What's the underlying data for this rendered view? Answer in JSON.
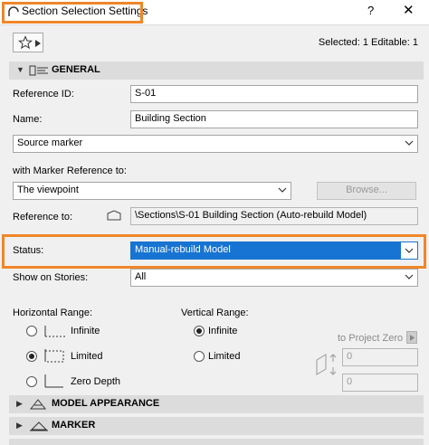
{
  "window": {
    "title": "Section Selection Settings",
    "help": "?",
    "close": "✕"
  },
  "toolbar": {
    "favorites_icon": "star-icon",
    "selected_info": "Selected: 1 Editable: 1"
  },
  "general": {
    "header": "GENERAL",
    "reference_id_label": "Reference ID:",
    "reference_id_value": "S-01",
    "name_label": "Name:",
    "name_value": "Building Section",
    "marker_type_value": "Source marker",
    "marker_ref_label": "with Marker Reference to:",
    "marker_ref_value": "The viewpoint",
    "browse_label": "Browse...",
    "reference_to_label": "Reference to:",
    "reference_to_value": "\\Sections\\S-01 Building Section (Auto-rebuild Model)",
    "status_label": "Status:",
    "status_value": "Manual-rebuild Model",
    "stories_label": "Show on Stories:",
    "stories_value": "All"
  },
  "horizontal_range": {
    "label": "Horizontal Range:",
    "options": [
      {
        "label": "Infinite",
        "selected": false
      },
      {
        "label": "Limited",
        "selected": true
      },
      {
        "label": "Zero Depth",
        "selected": false
      }
    ]
  },
  "vertical_range": {
    "label": "Vertical Range:",
    "options": [
      {
        "label": "Infinite",
        "selected": true
      },
      {
        "label": "Limited",
        "selected": false
      }
    ],
    "project_zero_label": "to Project Zero",
    "upper_value": "0",
    "lower_value": "0"
  },
  "sections": {
    "model_appearance": "MODEL APPEARANCE",
    "marker": "MARKER"
  },
  "colors": {
    "highlight": "#f0862a",
    "selection": "#1874d2"
  }
}
